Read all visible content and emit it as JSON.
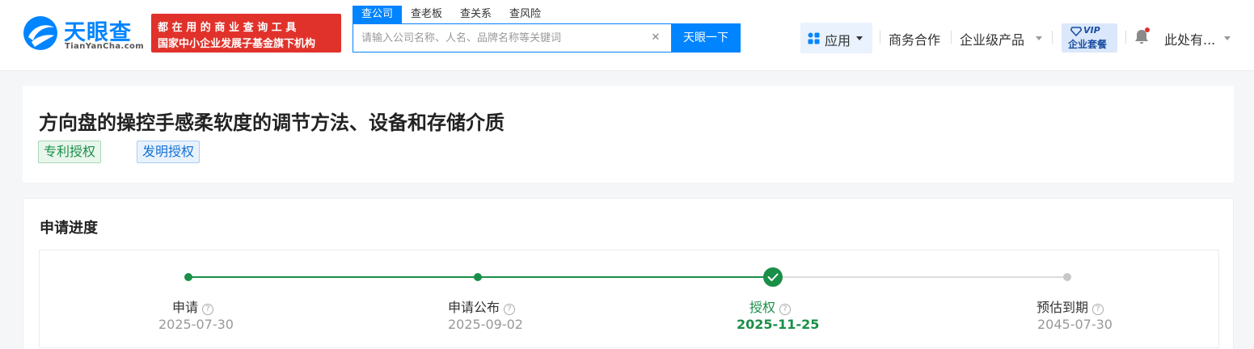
{
  "brand": {
    "logo_text": "天眼查",
    "logo_sub": "TianYanCha.com",
    "slogan_line1": "都在用的商业查询工具",
    "slogan_line2": "国家中小企业发展子基金旗下机构"
  },
  "search": {
    "tabs": [
      {
        "label": "查公司",
        "active": true
      },
      {
        "label": "查老板",
        "active": false
      },
      {
        "label": "查关系",
        "active": false
      },
      {
        "label": "查风险",
        "active": false
      }
    ],
    "placeholder": "请输入公司名称、人名、品牌名称等关键词",
    "button_label": "天眼一下"
  },
  "nav": {
    "apps_label": "应用",
    "business": "商务合作",
    "enterprise": "企业级产品",
    "vip_badge": "VIP",
    "vip_label": "企业套餐",
    "user_name": "此处有..."
  },
  "patent": {
    "title": "方向盘的操控手感柔软度的调节方法、设备和存储介质",
    "tags": [
      "专利授权",
      "发明授权"
    ]
  },
  "progress": {
    "section_title": "申请进度",
    "steps": [
      {
        "label": "申请",
        "date": "2025-07-30",
        "state": "done"
      },
      {
        "label": "申请公布",
        "date": "2025-09-02",
        "state": "done"
      },
      {
        "label": "授权",
        "date": "2025-11-25",
        "state": "current"
      },
      {
        "label": "预估到期",
        "date": "2045-07-30",
        "state": "future"
      }
    ]
  },
  "colors": {
    "brand_blue": "#0084ff",
    "slogan_red": "#e0322b",
    "progress_green": "#1a8f48",
    "pending_gray": "#c8c8c8"
  }
}
